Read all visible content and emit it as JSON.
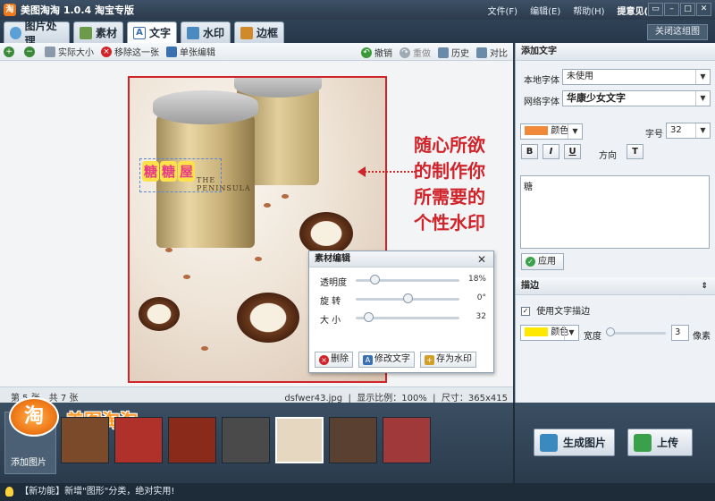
{
  "app": {
    "title": "美图淘淘 1.0.4 淘宝专版",
    "logo_char": "淘"
  },
  "menu": {
    "file": "文件(F)",
    "edit": "编辑(E)",
    "help": "帮助(H)",
    "user": "提意见(D)"
  },
  "window_buttons": {
    "min": "▭",
    "restore": "–",
    "max": "□",
    "close": "✕"
  },
  "tabs": [
    {
      "label": "图片处理",
      "color": "#5aa0d6"
    },
    {
      "label": "素材",
      "color": "#6a9a4a"
    },
    {
      "label": "文字",
      "color": "#3a6fb0"
    },
    {
      "label": "水印",
      "color": "#4a8ac0"
    },
    {
      "label": "边框",
      "color": "#d08a2a"
    }
  ],
  "close_picture": "关闭这组图",
  "toolbar": {
    "actual_size": "实际大小",
    "remove_one": "移除这一张",
    "single_edit": "单张编辑",
    "undo": "撤销",
    "redo": "重做",
    "history": "历史",
    "compare": "对比"
  },
  "canvas": {
    "tin_text": "THE PENINSULA",
    "watermark_chars": [
      "糖",
      "糖",
      "屋"
    ],
    "slogan_lines": [
      "随心所欲",
      "的制作你",
      "所需要的",
      "个性水印"
    ]
  },
  "material_editor": {
    "title": "素材编辑",
    "close": "✕",
    "opacity_label": "透明度",
    "opacity_value": "18%",
    "opacity_frac": 0.18,
    "rotate_label": "旋 转",
    "rotate_value": "0°",
    "rotate_frac": 0.5,
    "size_label": "大 小",
    "size_value": "32",
    "size_frac": 0.12,
    "delete": "删除",
    "edit_text": "修改文字",
    "save_watermark": "存为水印"
  },
  "status": {
    "page_info": "第 5 张，共 7 张",
    "filename": "dsfwer43.jpg",
    "zoom": "显示比例：100%",
    "size": "尺寸：365x415"
  },
  "panel": {
    "add_text_title": "添加文字",
    "local_font_label": "本地字体",
    "local_font_value": "未使用",
    "web_font_label": "网络字体",
    "web_font_value": "华康少女文字",
    "color_label": "颜色",
    "color_value": "#f08a3a",
    "font_size_label": "字号",
    "font_size_value": "32",
    "bold": "B",
    "italic": "I",
    "underline": "U",
    "direction_label": "方向",
    "direction_btn": "T",
    "text_content": "糖",
    "apply": "应用",
    "stroke_title": "描边",
    "stroke_checkbox": "使用文字描边",
    "stroke_color_label": "颜色",
    "stroke_color_value": "#ffe800",
    "width_label": "宽度",
    "width_value": "3",
    "pixels_label": "像素"
  },
  "bottom": {
    "brand": "美图淘淘",
    "brand_badge": "淘",
    "add_picture": "添加图片",
    "generate": "生成图片",
    "upload": "上传",
    "thumbs": [
      "#7a4a2a",
      "#b0302a",
      "#8a2a1a",
      "#4a4a4a",
      "#e6d8c0",
      "#5a4030",
      "#a03a3a"
    ],
    "selected_thumb": 4
  },
  "news": "【新功能】新增\"图形\"分类，绝对实用!"
}
